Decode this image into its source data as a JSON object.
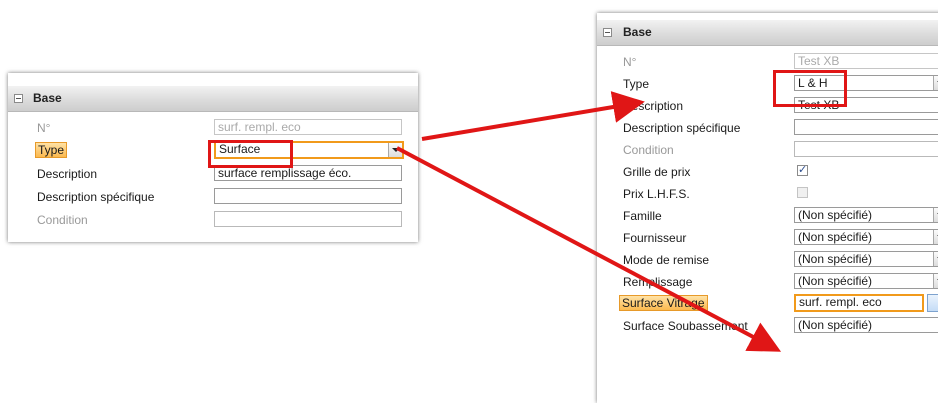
{
  "colors": {
    "highlight_border": "#e79a2a",
    "annotation_red": "#e01616",
    "header_gray": "#dcdcdc"
  },
  "left_panel": {
    "section_title": "Base",
    "rows": {
      "number": {
        "label": "N°",
        "value": "surf. rempl. eco"
      },
      "type": {
        "label": "Type",
        "value": "Surface"
      },
      "description": {
        "label": "Description",
        "value": "surface remplissage éco."
      },
      "specific_description": {
        "label": "Description spécifique",
        "value": ""
      },
      "condition": {
        "label": "Condition",
        "value": ""
      }
    }
  },
  "right_panel": {
    "section_title": "Base",
    "rows": {
      "number": {
        "label": "N°",
        "value": "Test XB"
      },
      "type": {
        "label": "Type",
        "value": "L & H"
      },
      "description": {
        "label": "Description",
        "value": "Test XB"
      },
      "specific_description": {
        "label": "Description spécifique",
        "value": ""
      },
      "condition": {
        "label": "Condition",
        "value": ""
      },
      "price_grid": {
        "label": "Grille de prix",
        "checked": true
      },
      "price_lhfs": {
        "label": "Prix L.H.F.S.",
        "checked": false
      },
      "family": {
        "label": "Famille",
        "value": "(Non spécifié)"
      },
      "supplier": {
        "label": "Fournisseur",
        "value": "(Non spécifié)"
      },
      "discount_mode": {
        "label": "Mode de remise",
        "value": "(Non spécifié)"
      },
      "filling": {
        "label": "Remplissage",
        "value": "(Non spécifié)"
      },
      "glazing_surface": {
        "label": "Surface Vitrage",
        "value": "surf. rempl. eco"
      },
      "base_surface": {
        "label": "Surface Soubassement",
        "value": "(Non spécifié)"
      }
    }
  }
}
